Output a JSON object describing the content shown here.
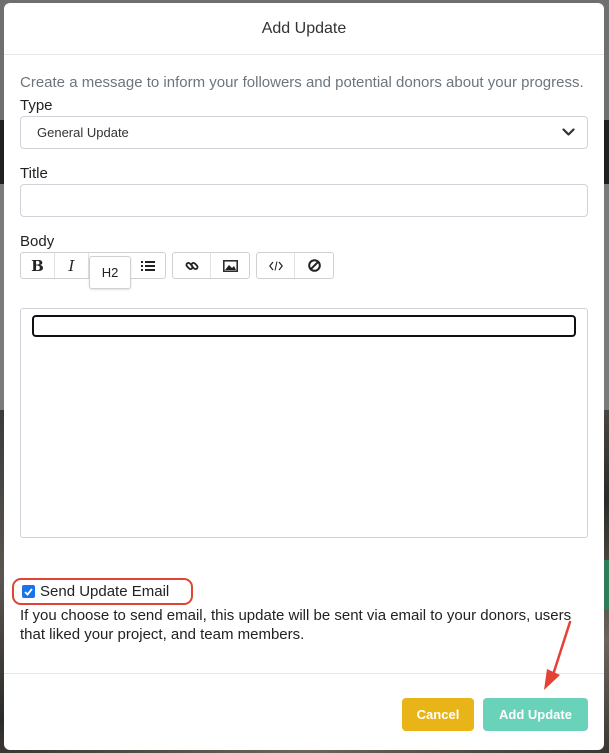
{
  "modal": {
    "title": "Add Update",
    "intro": "Create a message to inform your followers and potential donors about your progress."
  },
  "type_field": {
    "label": "Type",
    "selected": "General Update",
    "icon": "chevron-down-icon"
  },
  "title_field": {
    "label": "Title",
    "value": ""
  },
  "body_field": {
    "label": "Body",
    "toolbar": {
      "bold": "B",
      "italic": "I",
      "heading": "H2",
      "icons": [
        "list-icon",
        "link-icon",
        "image-icon",
        "code-icon",
        "clear-format-icon"
      ]
    },
    "content": ""
  },
  "email_option": {
    "label": "Send Update Email",
    "checked": true,
    "help": "If you choose to send email, this update will be sent via email to your donors, users that liked your project, and team members."
  },
  "footer": {
    "cancel_label": "Cancel",
    "submit_label": "Add Update"
  },
  "colors": {
    "cancel": "#e8b417",
    "submit": "#69d2b8",
    "highlight": "#e34234",
    "checkbox": "#1a73e8"
  }
}
